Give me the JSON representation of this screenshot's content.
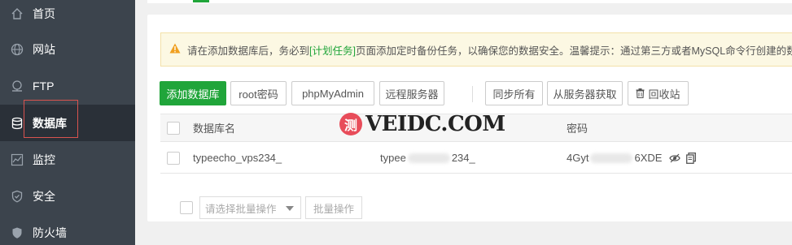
{
  "sidebar": {
    "items": [
      {
        "label": "首页",
        "icon": "home-icon"
      },
      {
        "label": "网站",
        "icon": "globe-icon"
      },
      {
        "label": "FTP",
        "icon": "ftp-icon"
      },
      {
        "label": "数据库",
        "icon": "database-icon",
        "active": true
      },
      {
        "label": "监控",
        "icon": "monitor-icon"
      },
      {
        "label": "安全",
        "icon": "shield-icon"
      },
      {
        "label": "防火墙",
        "icon": "firewall-icon"
      }
    ]
  },
  "notice": {
    "prefix": "请在添加数据库后，务必到",
    "link": "[计划任务]",
    "suffix": "页面添加定时备份任务，以确保您的数据安全。温馨提示：通过第三方或者MySQL命令行创建的数据库"
  },
  "toolbar": {
    "add_db": "添加数据库",
    "root_pwd": "root密码",
    "phpmyadmin": "phpMyAdmin",
    "remote": "远程服务器",
    "sync_all": "同步所有",
    "fetch": "从服务器获取",
    "recycle": "回收站"
  },
  "table": {
    "headers": {
      "name": "数据库名",
      "password": "密码"
    },
    "rows": [
      {
        "name": "typeecho_vps234_",
        "user_prefix": "typee",
        "user_suffix": "234_",
        "pwd_prefix": "4Gyt",
        "pwd_suffix": "6XDE"
      }
    ]
  },
  "footer": {
    "select_placeholder": "请选择批量操作",
    "batch_btn": "批量操作"
  },
  "watermark": {
    "logo": "测",
    "text": "VEIDC.COM"
  },
  "colors": {
    "accent": "#20a53a",
    "sidebar_bg": "#3c444d",
    "highlight_border": "#d9534f"
  }
}
